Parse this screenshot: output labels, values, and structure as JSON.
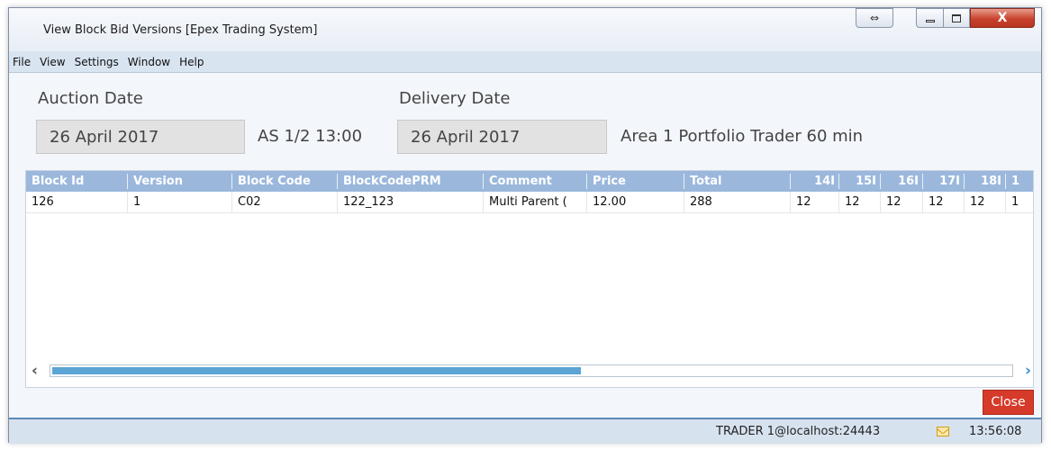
{
  "window": {
    "title": "View Block Bid Versions [Epex Trading System]",
    "controls": {
      "swap": "⇔",
      "close": "X"
    }
  },
  "menu": [
    {
      "label": "File"
    },
    {
      "label": "View"
    },
    {
      "label": "Settings"
    },
    {
      "label": "Window"
    },
    {
      "label": "Help"
    }
  ],
  "form": {
    "auction_date_label": "Auction Date",
    "auction_date_value": "26 April 2017",
    "auction_session": "AS 1/2 13:00",
    "delivery_date_label": "Delivery Date",
    "delivery_date_value": "26 April 2017",
    "area_portfolio": "Area 1 Portfolio Trader 60 min"
  },
  "grid": {
    "columns": [
      "Block Id",
      "Version",
      "Block Code",
      "BlockCodePRM",
      "Comment",
      "Price",
      "Total",
      "14I",
      "15I",
      "16I",
      "17I",
      "18I",
      "1"
    ],
    "rows": [
      [
        "126",
        "1",
        "C02",
        "122_123",
        "Multi Parent (",
        "12.00",
        "288",
        "12",
        "12",
        "12",
        "12",
        "12",
        "1"
      ]
    ],
    "scroll_fraction": 0.55
  },
  "buttons": {
    "close": "Close"
  },
  "status": {
    "user": "TRADER 1@localhost:24443",
    "time": "13:56:08"
  },
  "colors": {
    "header_bg": "#9bb8dc",
    "close_button": "#d53a2a",
    "scroll_thumb": "#5ba5d5"
  },
  "icons": [
    "swap-icon",
    "minimize-icon",
    "maximize-icon",
    "close-icon",
    "scroll-left-icon",
    "scroll-right-icon",
    "mail-icon"
  ]
}
